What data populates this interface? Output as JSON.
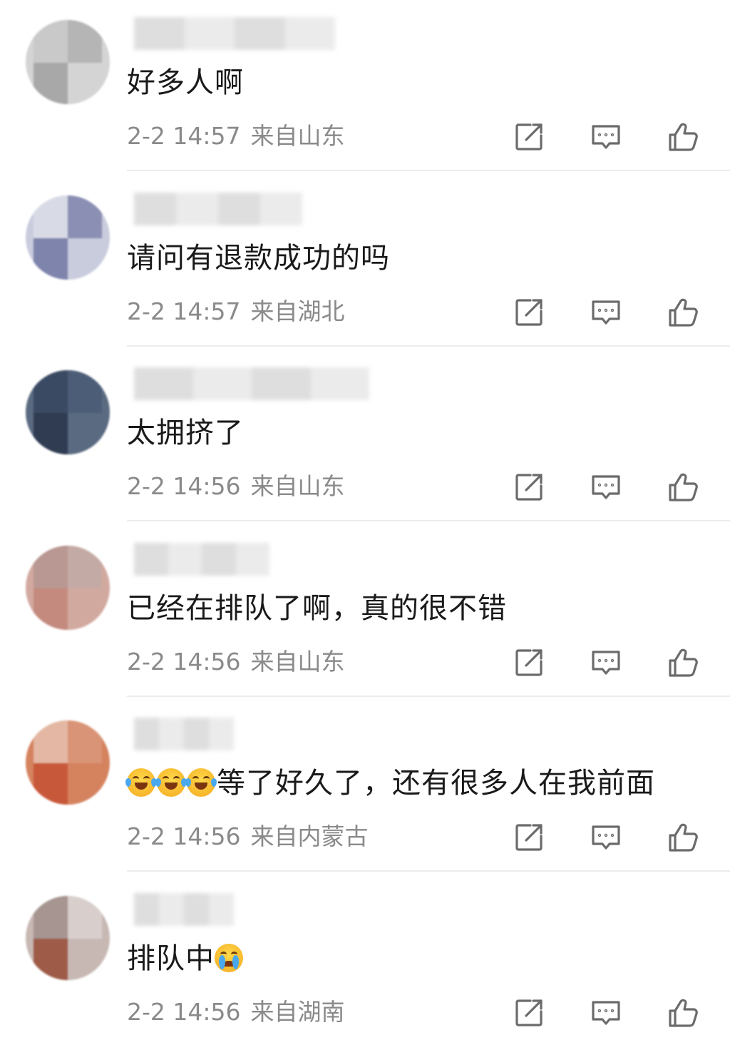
{
  "comments": [
    {
      "avatar_colors": [
        "#c9c9c9",
        "#b5b5b5",
        "#a8a8a8",
        "#d4d4d4"
      ],
      "username_blurred": true,
      "emoji_prefix": [],
      "text": "好多人啊",
      "emoji_suffix": [],
      "time": "2-2 14:57",
      "location": "来自山东"
    },
    {
      "avatar_colors": [
        "#d8dbe6",
        "#8a8fb3",
        "#7e84ab",
        "#c9ccdd"
      ],
      "username_blurred": true,
      "emoji_prefix": [],
      "text": "请问有退款成功的吗",
      "emoji_suffix": [],
      "time": "2-2 14:57",
      "location": "来自湖北"
    },
    {
      "avatar_colors": [
        "#3b4a63",
        "#4c5d78",
        "#2f3c52",
        "#5a6a80"
      ],
      "username_blurred": true,
      "emoji_prefix": [],
      "text": "太拥挤了",
      "emoji_suffix": [],
      "time": "2-2 14:56",
      "location": "来自山东"
    },
    {
      "avatar_colors": [
        "#b99792",
        "#c4aaa4",
        "#c58a7e",
        "#d2a99f"
      ],
      "username_blurred": true,
      "emoji_prefix": [],
      "text": "已经在排队了啊，真的很不错",
      "emoji_suffix": [],
      "time": "2-2 14:56",
      "location": "来自山东"
    },
    {
      "avatar_colors": [
        "#e3b7a3",
        "#d99477",
        "#c8583a",
        "#d5825f"
      ],
      "username_blurred": true,
      "emoji_prefix": [
        "laugh-cry",
        "laugh-cry",
        "laugh-cry"
      ],
      "text": "等了好久了，还有很多人在我前面",
      "emoji_suffix": [],
      "time": "2-2 14:56",
      "location": "来自内蒙古"
    },
    {
      "avatar_colors": [
        "#a69591",
        "#d8cfcd",
        "#9d5b48",
        "#c8b8b4"
      ],
      "username_blurred": true,
      "emoji_prefix": [],
      "text": "排队中",
      "emoji_suffix": [
        "cry"
      ],
      "time": "2-2 14:56",
      "location": "来自湖南"
    }
  ],
  "icons": {
    "forward": "forward-icon",
    "reply": "comment-icon",
    "like": "thumbs-up-icon"
  },
  "colors": {
    "text": "#1a1a1a",
    "meta": "#8a8a8a",
    "icon": "#6b6b6b",
    "divider": "#ececec"
  }
}
